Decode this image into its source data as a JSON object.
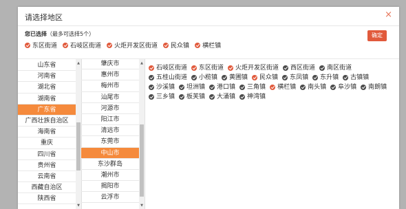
{
  "dialog": {
    "title": "请选择地区",
    "close": "×"
  },
  "selected": {
    "head_label": "您已选择",
    "head_note": "（最多可选择5个）",
    "confirm": "确定",
    "items": [
      "东区街道",
      "石岐区街道",
      "火炬开发区街道",
      "民众镇",
      "横栏镇"
    ]
  },
  "provinces": [
    "山东省",
    "河南省",
    "湖北省",
    "湖南省",
    "广东省",
    "广西壮族自治区",
    "海南省",
    "重庆",
    "四川省",
    "贵州省",
    "云南省",
    "西藏自治区",
    "陕西省"
  ],
  "provinces_active": 4,
  "cities": [
    "肇庆市",
    "惠州市",
    "梅州市",
    "汕尾市",
    "河源市",
    "阳江市",
    "清远市",
    "东莞市",
    "中山市",
    "东沙群岛",
    "潮州市",
    "揭阳市",
    "云浮市"
  ],
  "cities_active": 8,
  "towns": [
    {
      "name": "石岐区街道",
      "checked": true
    },
    {
      "name": "东区街道",
      "checked": true
    },
    {
      "name": "火炬开发区街道",
      "checked": true
    },
    {
      "name": "西区街道",
      "checked": false
    },
    {
      "name": "南区街道",
      "checked": false
    },
    {
      "name": "五桂山街道",
      "checked": false
    },
    {
      "name": "小榄镇",
      "checked": false
    },
    {
      "name": "黄圃镇",
      "checked": false
    },
    {
      "name": "民众镇",
      "checked": true
    },
    {
      "name": "东凤镇",
      "checked": false
    },
    {
      "name": "东升镇",
      "checked": false
    },
    {
      "name": "古镇镇",
      "checked": false
    },
    {
      "name": "沙溪镇",
      "checked": false
    },
    {
      "name": "坦洲镇",
      "checked": false
    },
    {
      "name": "港口镇",
      "checked": false
    },
    {
      "name": "三角镇",
      "checked": false
    },
    {
      "name": "横栏镇",
      "checked": true
    },
    {
      "name": "南头镇",
      "checked": false
    },
    {
      "name": "阜沙镇",
      "checked": false
    },
    {
      "name": "南朗镇",
      "checked": false
    },
    {
      "name": "三乡镇",
      "checked": false
    },
    {
      "name": "板芙镇",
      "checked": false
    },
    {
      "name": "大涌镇",
      "checked": false
    },
    {
      "name": "神湾镇",
      "checked": false
    }
  ],
  "icons": {
    "checked": "check-circle-red",
    "unchecked": "check-circle-gray",
    "close": "close-x"
  },
  "colors": {
    "accent": "#e15a3c",
    "active_bg": "#f58a3c",
    "unchecked": "#4b4b4b",
    "close": "#e67357"
  }
}
